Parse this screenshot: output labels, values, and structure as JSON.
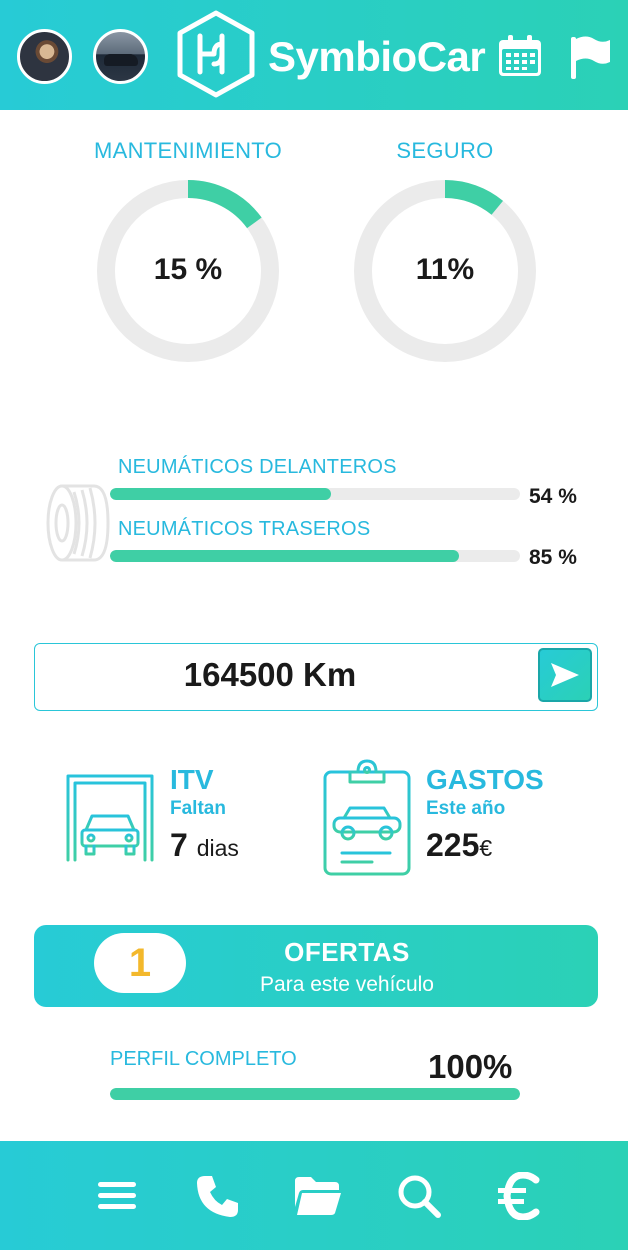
{
  "header": {
    "app_name": "SymbioCar",
    "logo_mark": "H",
    "icons": [
      "user-avatar",
      "vehicle-avatar",
      "calendar-icon",
      "flag-icon"
    ]
  },
  "gauges": [
    {
      "label": "MANTENIMIENTO",
      "display": "15 %",
      "value": 15
    },
    {
      "label": "SEGURO",
      "display": "11%",
      "value": 11
    }
  ],
  "tires": {
    "icon": "tire-icon",
    "front": {
      "label": "NEUMÁTICOS DELANTEROS",
      "display": "54 %",
      "value": 54
    },
    "rear": {
      "label": "NEUMÁTICOS TRASEROS",
      "display": "85 %",
      "value": 85
    }
  },
  "mileage": {
    "value": "164500 Km",
    "send_icon": "send-icon"
  },
  "itv": {
    "title": "ITV",
    "subtitle": "Faltan",
    "value": "7",
    "unit": "dias",
    "icon": "car-wash-icon"
  },
  "gastos": {
    "title": "GASTOS",
    "subtitle": "Este año",
    "value": "225",
    "unit": "€",
    "icon": "clipboard-car-icon"
  },
  "offers": {
    "count": "1",
    "title": "OFERTAS",
    "subtitle": "Para este vehículo"
  },
  "perfil": {
    "label": "PERFIL COMPLETO",
    "display": "100%",
    "value": 100
  },
  "nav": {
    "items": [
      "menu-icon",
      "phone-icon",
      "folder-icon",
      "search-icon",
      "euro-icon"
    ]
  },
  "colors": {
    "header_gradient_start": "#27cbd6",
    "header_gradient_end": "#2bd1b6",
    "accent_text": "#28b9de",
    "progress_fill": "#3fcfa5",
    "track": "#ebebeb",
    "offer_count": "#f3b82c"
  }
}
